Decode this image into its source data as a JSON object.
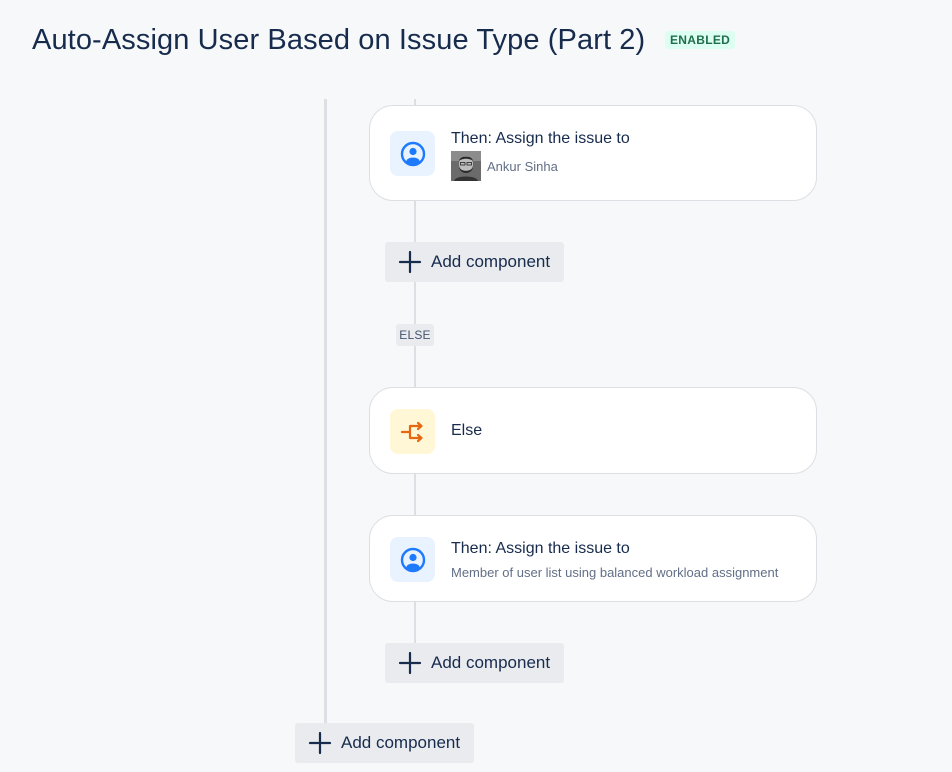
{
  "header": {
    "title": "Auto-Assign User Based on Issue Type (Part 2)",
    "status_badge": "ENABLED"
  },
  "flow": {
    "branch1": {
      "action": {
        "title": "Then: Assign the issue to",
        "assignee_name": "Ankur Sinha",
        "icon": "user-circle-icon"
      },
      "add_component_label": "Add component"
    },
    "else_lozenge": "ELSE",
    "else_block": {
      "title": "Else",
      "icon": "branch-icon"
    },
    "branch2": {
      "action": {
        "title": "Then: Assign the issue to",
        "subtitle": "Member of user list using balanced workload assignment",
        "icon": "user-circle-icon"
      },
      "add_component_label": "Add component"
    },
    "outer_add_component_label": "Add component"
  },
  "colors": {
    "accent_blue": "#1d7afc",
    "accent_orange": "#e56910",
    "badge_bg": "#dcfff1",
    "badge_text": "#216e4e"
  }
}
